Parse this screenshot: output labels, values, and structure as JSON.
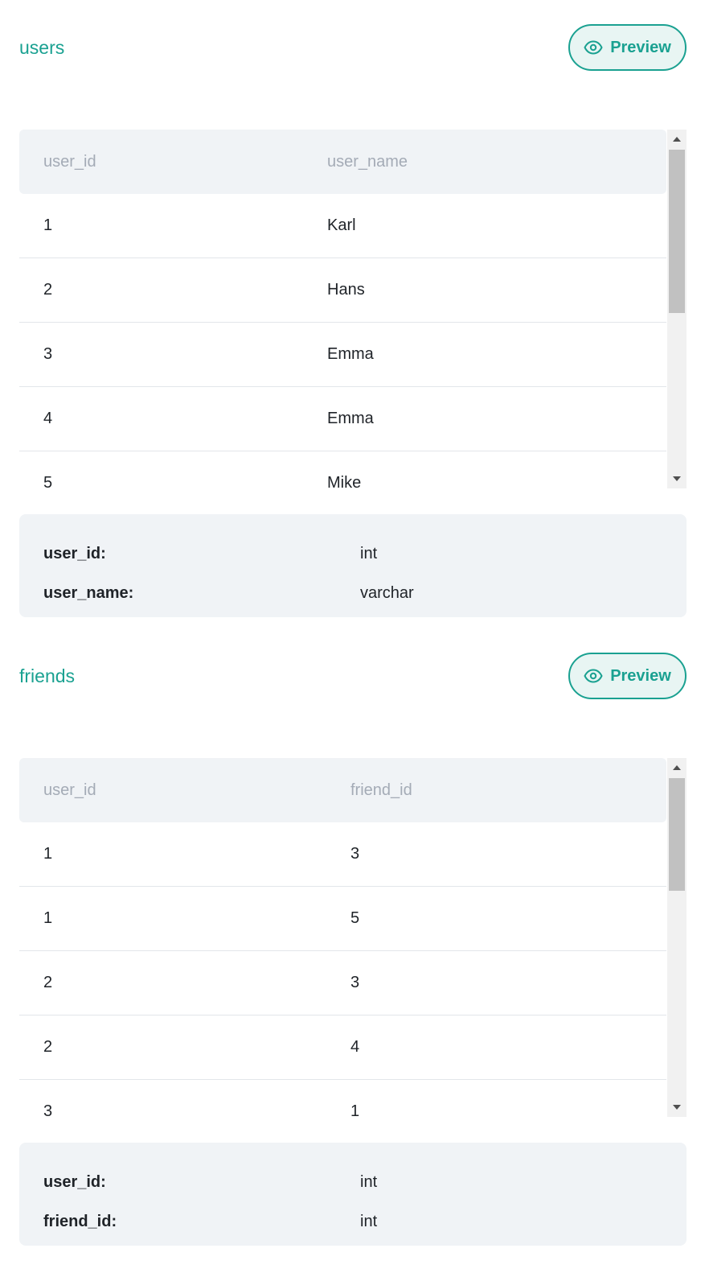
{
  "colors": {
    "accent": "#1aa191",
    "accent_bg": "#e8f5f3",
    "panel_bg": "#f0f3f6",
    "header_text": "#a4abb6",
    "row_divider": "#e3e6ea",
    "scrollbar_track": "#f1f1f1",
    "scrollbar_thumb": "#c1c1c1"
  },
  "tables": [
    {
      "name": "users",
      "preview_label": "Preview",
      "preview_icon": "eye-icon",
      "columns": [
        "user_id",
        "user_name"
      ],
      "rows": [
        [
          "1",
          "Karl"
        ],
        [
          "2",
          "Hans"
        ],
        [
          "3",
          "Emma"
        ],
        [
          "4",
          "Emma"
        ],
        [
          "5",
          "Mike"
        ]
      ],
      "schema": [
        {
          "key": "user_id:",
          "type": "int"
        },
        {
          "key": "user_name:",
          "type": "varchar"
        }
      ]
    },
    {
      "name": "friends",
      "preview_label": "Preview",
      "preview_icon": "eye-icon",
      "columns": [
        "user_id",
        "friend_id"
      ],
      "rows": [
        [
          "1",
          "3"
        ],
        [
          "1",
          "5"
        ],
        [
          "2",
          "3"
        ],
        [
          "2",
          "4"
        ],
        [
          "3",
          "1"
        ]
      ],
      "schema": [
        {
          "key": "user_id:",
          "type": "int"
        },
        {
          "key": "friend_id:",
          "type": "int"
        }
      ]
    }
  ]
}
